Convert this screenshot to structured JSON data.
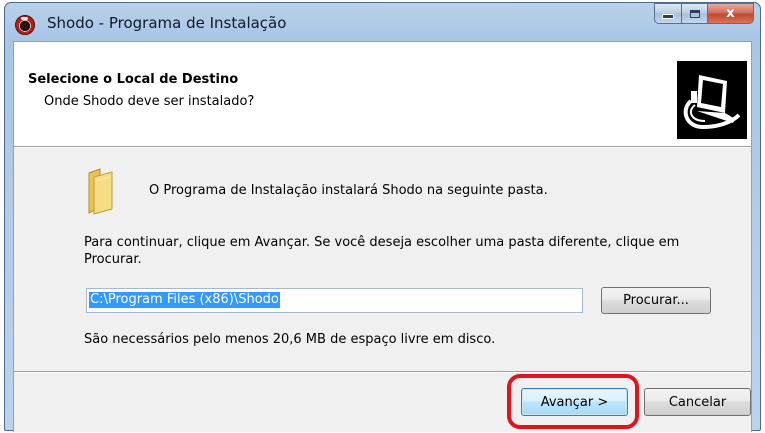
{
  "window": {
    "title": "Shodo - Programa de Instalação",
    "minimize_symbol": "",
    "close_symbol": "x"
  },
  "header": {
    "title": "Selecione o Local de Destino",
    "subtitle": "Onde Shodo deve ser instalado?",
    "image_icon": "computer-install-icon"
  },
  "body": {
    "folder_icon": "folder-icon",
    "intro": "O Programa de Instalação instalará Shodo na seguinte pasta.",
    "instruction": "Para continuar, clique em Avançar. Se você deseja escolher uma pasta diferente, clique em Procurar.",
    "path_value": "C:\\Program Files (x86)\\Shodo",
    "browse_label": "Procurar...",
    "space_required": "São necessários pelo menos 20,6 MB de espaço livre em disco."
  },
  "footer": {
    "next_label": "Avançar >",
    "cancel_label": "Cancelar"
  },
  "colors": {
    "highlight": "#e0141e",
    "selection": "#3399ff"
  }
}
